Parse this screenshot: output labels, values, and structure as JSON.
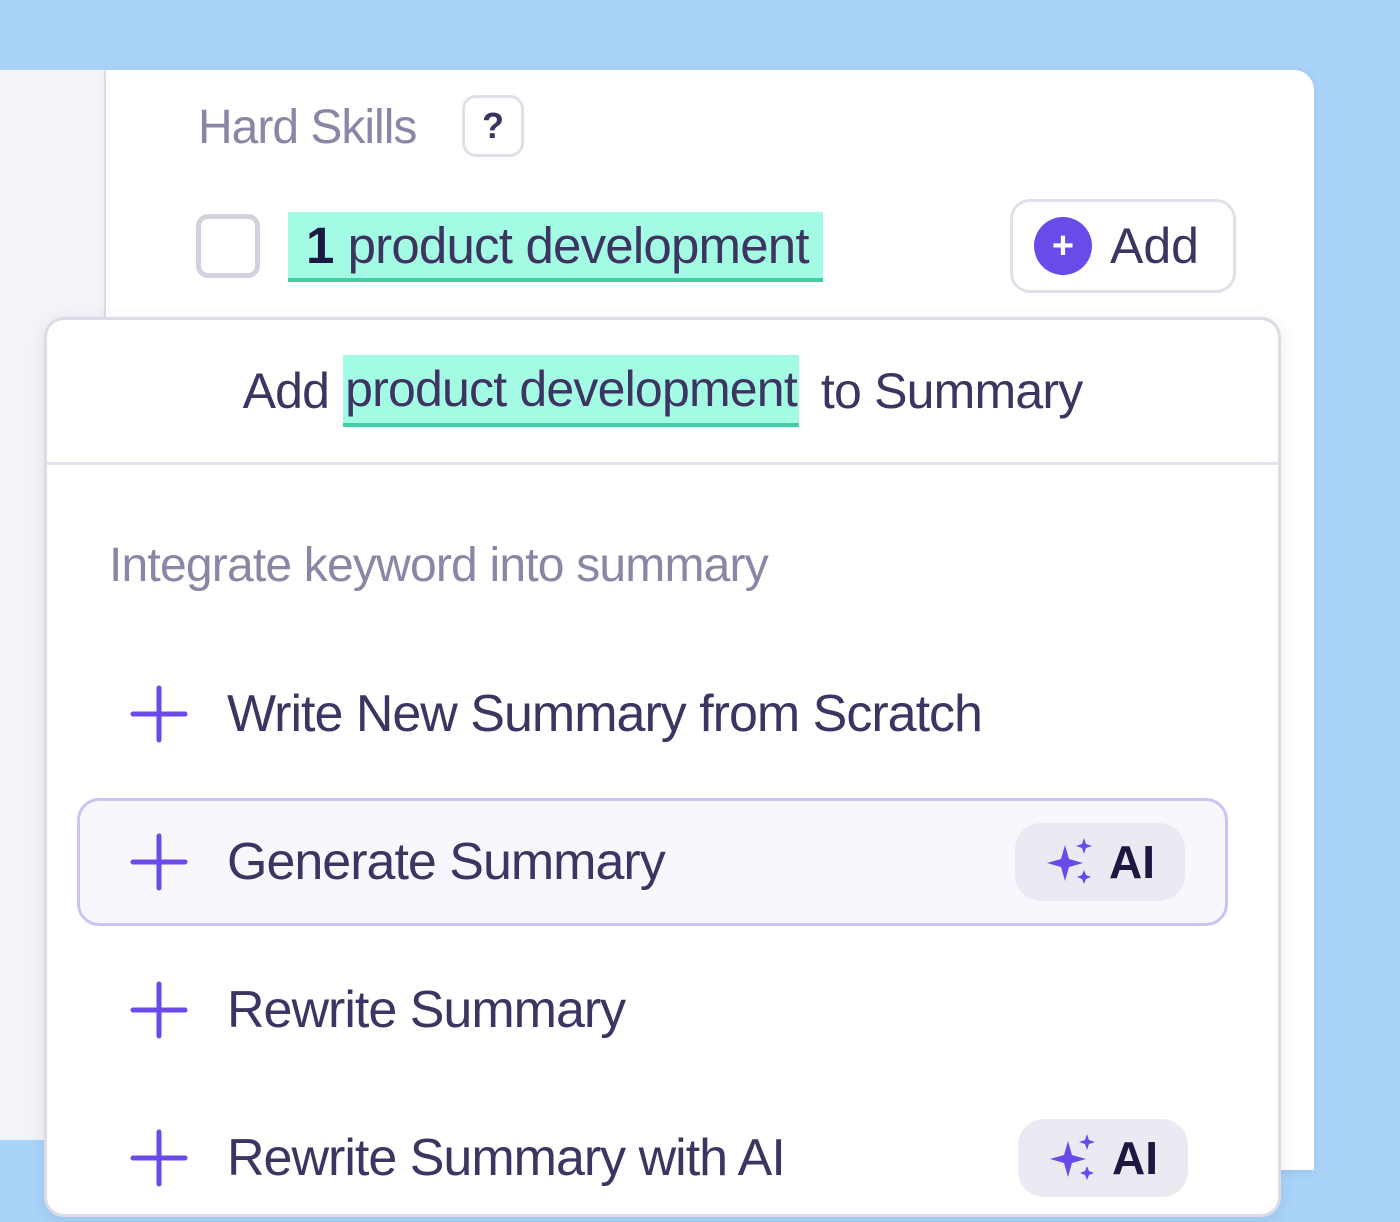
{
  "skills": {
    "section_title": "Hard Skills",
    "help_label": "?",
    "keyword_count": "1",
    "keyword": "product development",
    "add_label": "Add"
  },
  "dropdown": {
    "header_prefix": "Add",
    "header_keyword": "product development",
    "header_suffix": "to Summary",
    "subtitle": "Integrate keyword into summary",
    "options": [
      {
        "label": "Write New Summary from Scratch",
        "ai": ""
      },
      {
        "label": "Generate Summary",
        "ai": "AI"
      },
      {
        "label": "Rewrite Summary",
        "ai": ""
      },
      {
        "label": "Rewrite Summary with AI",
        "ai": "AI"
      }
    ]
  },
  "colors": {
    "accent": "#6a4ae8",
    "highlight": "#a4fbe3",
    "highlight_border": "#3fcfa5",
    "text_dark": "#3d3461",
    "text_muted": "#8a87a6",
    "background": "#a9d3f7"
  },
  "icons": {
    "help": "question-mark-icon",
    "add": "plus-circle-icon",
    "option": "plus-icon",
    "ai": "sparkle-icon"
  }
}
